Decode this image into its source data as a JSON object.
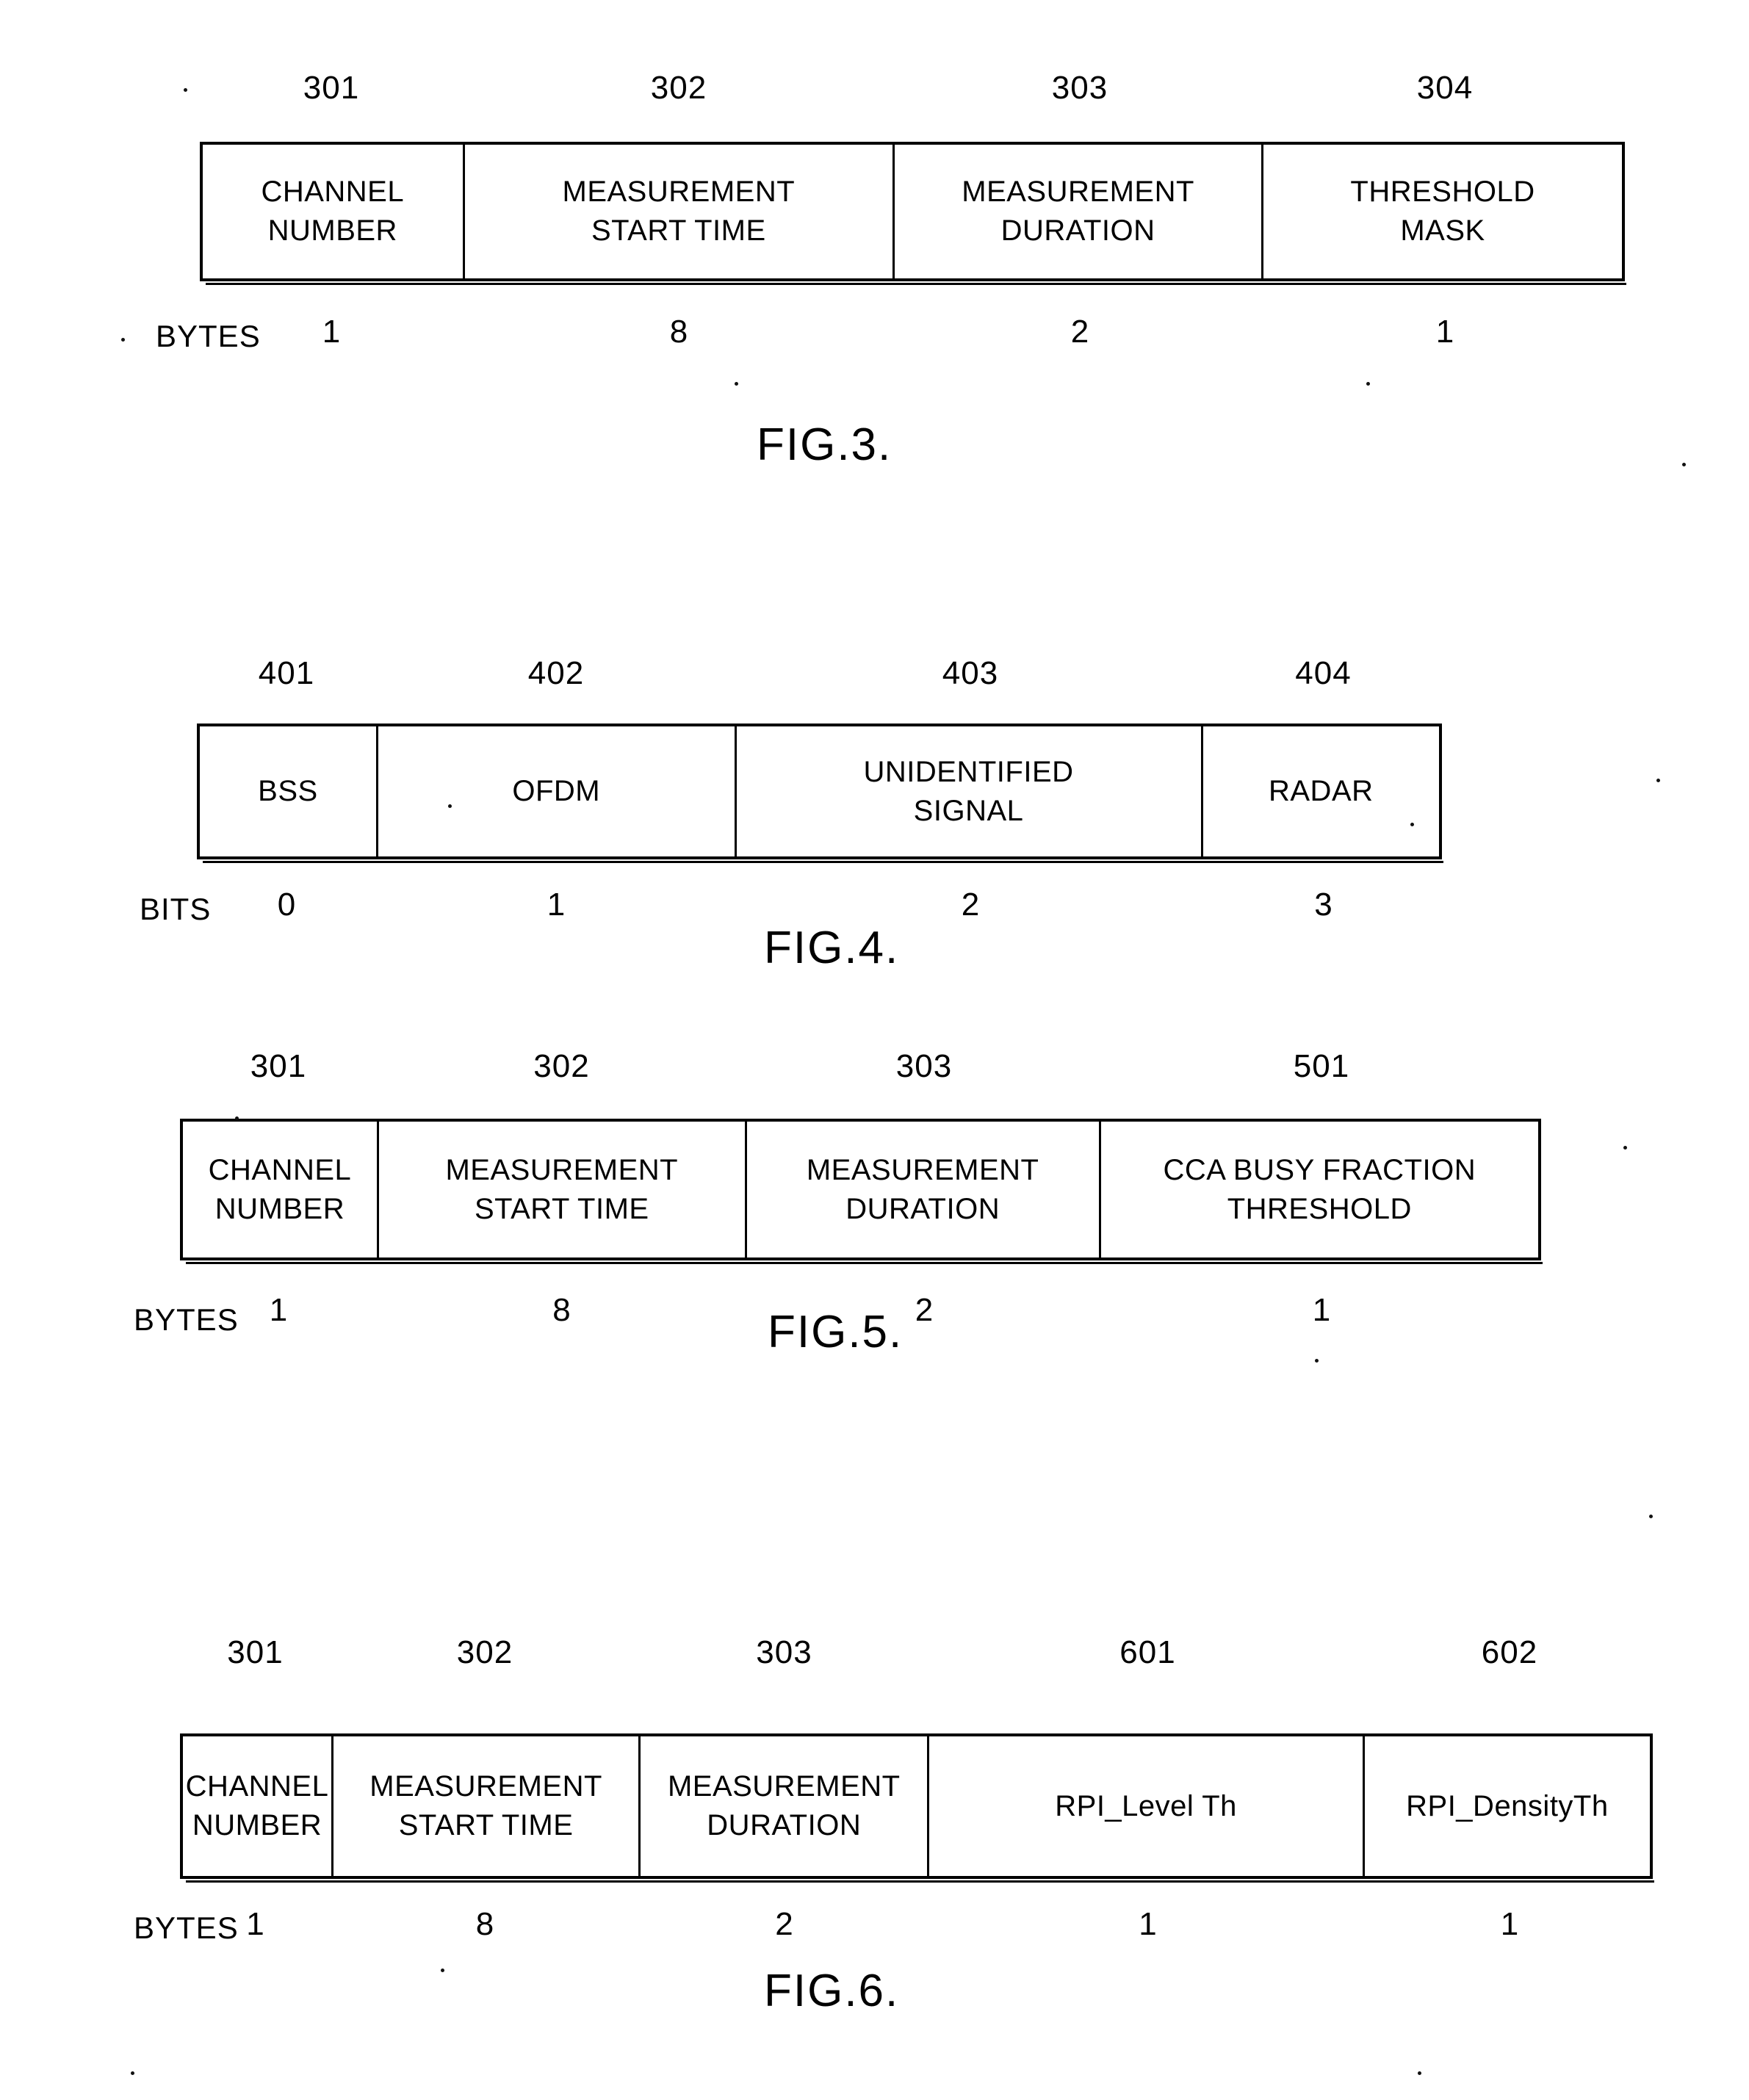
{
  "figures": [
    {
      "id": "fig3",
      "caption": "FIG.3.",
      "units_label": "BYTES",
      "refs": [
        "301",
        "302",
        "303",
        "304"
      ],
      "fields": [
        {
          "line1": "CHANNEL",
          "line2": "NUMBER"
        },
        {
          "line1": "MEASUREMENT",
          "line2": "START  TIME"
        },
        {
          "line1": "MEASUREMENT",
          "line2": "DURATION"
        },
        {
          "line1": "THRESHOLD",
          "line2": "MASK"
        }
      ],
      "units": [
        "1",
        "8",
        "2",
        "1"
      ],
      "widths": [
        946,
        504,
        490,
        0
      ]
    },
    {
      "id": "fig4",
      "caption": "FIG.4.",
      "units_label": "BITS",
      "refs": [
        "401",
        "402",
        "403",
        "404"
      ],
      "fields": [
        {
          "line1": "BSS",
          "line2": ""
        },
        {
          "line1": "OFDM",
          "line2": ""
        },
        {
          "line1": "UNIDENTIFIED",
          "line2": "SIGNAL"
        },
        {
          "line1": "RADAR",
          "line2": ""
        }
      ],
      "units": [
        "0",
        "1",
        "2",
        "3"
      ],
      "widths": [
        0,
        0,
        0,
        0
      ]
    },
    {
      "id": "fig5",
      "caption": "FIG.5.",
      "units_label": "BYTES",
      "refs": [
        "301",
        "302",
        "303",
        "501"
      ],
      "fields": [
        {
          "line1": "CHANNEL",
          "line2": "NUMBER"
        },
        {
          "line1": "MEASUREMENT",
          "line2": "START  TIME"
        },
        {
          "line1": "MEASUREMENT",
          "line2": "DURATION"
        },
        {
          "line1": "CCA BUSY FRACTION",
          "line2": "THRESHOLD"
        }
      ],
      "units": [
        "1",
        "8",
        "2",
        "1"
      ],
      "widths": [
        0,
        0,
        0,
        0
      ]
    },
    {
      "id": "fig6",
      "caption": "FIG.6.",
      "units_label": "BYTES",
      "refs": [
        "301",
        "302",
        "303",
        "601",
        "602"
      ],
      "fields": [
        {
          "line1": "CHANNEL",
          "line2": "NUMBER"
        },
        {
          "line1": "MEASUREMENT",
          "line2": "START  TIME"
        },
        {
          "line1": "MEASUREMENT",
          "line2": "DURATION"
        },
        {
          "line1": "RPI_Level Th",
          "line2": ""
        },
        {
          "line1": "RPI_DensityTh",
          "line2": ""
        }
      ],
      "units": [
        "1",
        "8",
        "2",
        "1",
        "1"
      ],
      "widths": [
        0,
        0,
        0,
        0,
        0
      ]
    }
  ]
}
